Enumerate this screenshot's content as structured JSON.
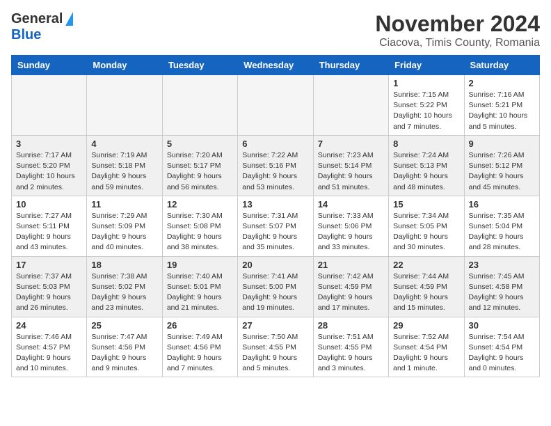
{
  "header": {
    "logo_general": "General",
    "logo_blue": "Blue",
    "month": "November 2024",
    "location": "Ciacova, Timis County, Romania"
  },
  "weekdays": [
    "Sunday",
    "Monday",
    "Tuesday",
    "Wednesday",
    "Thursday",
    "Friday",
    "Saturday"
  ],
  "weeks": [
    [
      {
        "day": "",
        "info": ""
      },
      {
        "day": "",
        "info": ""
      },
      {
        "day": "",
        "info": ""
      },
      {
        "day": "",
        "info": ""
      },
      {
        "day": "",
        "info": ""
      },
      {
        "day": "1",
        "info": "Sunrise: 7:15 AM\nSunset: 5:22 PM\nDaylight: 10 hours\nand 7 minutes."
      },
      {
        "day": "2",
        "info": "Sunrise: 7:16 AM\nSunset: 5:21 PM\nDaylight: 10 hours\nand 5 minutes."
      }
    ],
    [
      {
        "day": "3",
        "info": "Sunrise: 7:17 AM\nSunset: 5:20 PM\nDaylight: 10 hours\nand 2 minutes."
      },
      {
        "day": "4",
        "info": "Sunrise: 7:19 AM\nSunset: 5:18 PM\nDaylight: 9 hours\nand 59 minutes."
      },
      {
        "day": "5",
        "info": "Sunrise: 7:20 AM\nSunset: 5:17 PM\nDaylight: 9 hours\nand 56 minutes."
      },
      {
        "day": "6",
        "info": "Sunrise: 7:22 AM\nSunset: 5:16 PM\nDaylight: 9 hours\nand 53 minutes."
      },
      {
        "day": "7",
        "info": "Sunrise: 7:23 AM\nSunset: 5:14 PM\nDaylight: 9 hours\nand 51 minutes."
      },
      {
        "day": "8",
        "info": "Sunrise: 7:24 AM\nSunset: 5:13 PM\nDaylight: 9 hours\nand 48 minutes."
      },
      {
        "day": "9",
        "info": "Sunrise: 7:26 AM\nSunset: 5:12 PM\nDaylight: 9 hours\nand 45 minutes."
      }
    ],
    [
      {
        "day": "10",
        "info": "Sunrise: 7:27 AM\nSunset: 5:11 PM\nDaylight: 9 hours\nand 43 minutes."
      },
      {
        "day": "11",
        "info": "Sunrise: 7:29 AM\nSunset: 5:09 PM\nDaylight: 9 hours\nand 40 minutes."
      },
      {
        "day": "12",
        "info": "Sunrise: 7:30 AM\nSunset: 5:08 PM\nDaylight: 9 hours\nand 38 minutes."
      },
      {
        "day": "13",
        "info": "Sunrise: 7:31 AM\nSunset: 5:07 PM\nDaylight: 9 hours\nand 35 minutes."
      },
      {
        "day": "14",
        "info": "Sunrise: 7:33 AM\nSunset: 5:06 PM\nDaylight: 9 hours\nand 33 minutes."
      },
      {
        "day": "15",
        "info": "Sunrise: 7:34 AM\nSunset: 5:05 PM\nDaylight: 9 hours\nand 30 minutes."
      },
      {
        "day": "16",
        "info": "Sunrise: 7:35 AM\nSunset: 5:04 PM\nDaylight: 9 hours\nand 28 minutes."
      }
    ],
    [
      {
        "day": "17",
        "info": "Sunrise: 7:37 AM\nSunset: 5:03 PM\nDaylight: 9 hours\nand 26 minutes."
      },
      {
        "day": "18",
        "info": "Sunrise: 7:38 AM\nSunset: 5:02 PM\nDaylight: 9 hours\nand 23 minutes."
      },
      {
        "day": "19",
        "info": "Sunrise: 7:40 AM\nSunset: 5:01 PM\nDaylight: 9 hours\nand 21 minutes."
      },
      {
        "day": "20",
        "info": "Sunrise: 7:41 AM\nSunset: 5:00 PM\nDaylight: 9 hours\nand 19 minutes."
      },
      {
        "day": "21",
        "info": "Sunrise: 7:42 AM\nSunset: 4:59 PM\nDaylight: 9 hours\nand 17 minutes."
      },
      {
        "day": "22",
        "info": "Sunrise: 7:44 AM\nSunset: 4:59 PM\nDaylight: 9 hours\nand 15 minutes."
      },
      {
        "day": "23",
        "info": "Sunrise: 7:45 AM\nSunset: 4:58 PM\nDaylight: 9 hours\nand 12 minutes."
      }
    ],
    [
      {
        "day": "24",
        "info": "Sunrise: 7:46 AM\nSunset: 4:57 PM\nDaylight: 9 hours\nand 10 minutes."
      },
      {
        "day": "25",
        "info": "Sunrise: 7:47 AM\nSunset: 4:56 PM\nDaylight: 9 hours\nand 9 minutes."
      },
      {
        "day": "26",
        "info": "Sunrise: 7:49 AM\nSunset: 4:56 PM\nDaylight: 9 hours\nand 7 minutes."
      },
      {
        "day": "27",
        "info": "Sunrise: 7:50 AM\nSunset: 4:55 PM\nDaylight: 9 hours\nand 5 minutes."
      },
      {
        "day": "28",
        "info": "Sunrise: 7:51 AM\nSunset: 4:55 PM\nDaylight: 9 hours\nand 3 minutes."
      },
      {
        "day": "29",
        "info": "Sunrise: 7:52 AM\nSunset: 4:54 PM\nDaylight: 9 hours\nand 1 minute."
      },
      {
        "day": "30",
        "info": "Sunrise: 7:54 AM\nSunset: 4:54 PM\nDaylight: 9 hours\nand 0 minutes."
      }
    ]
  ]
}
